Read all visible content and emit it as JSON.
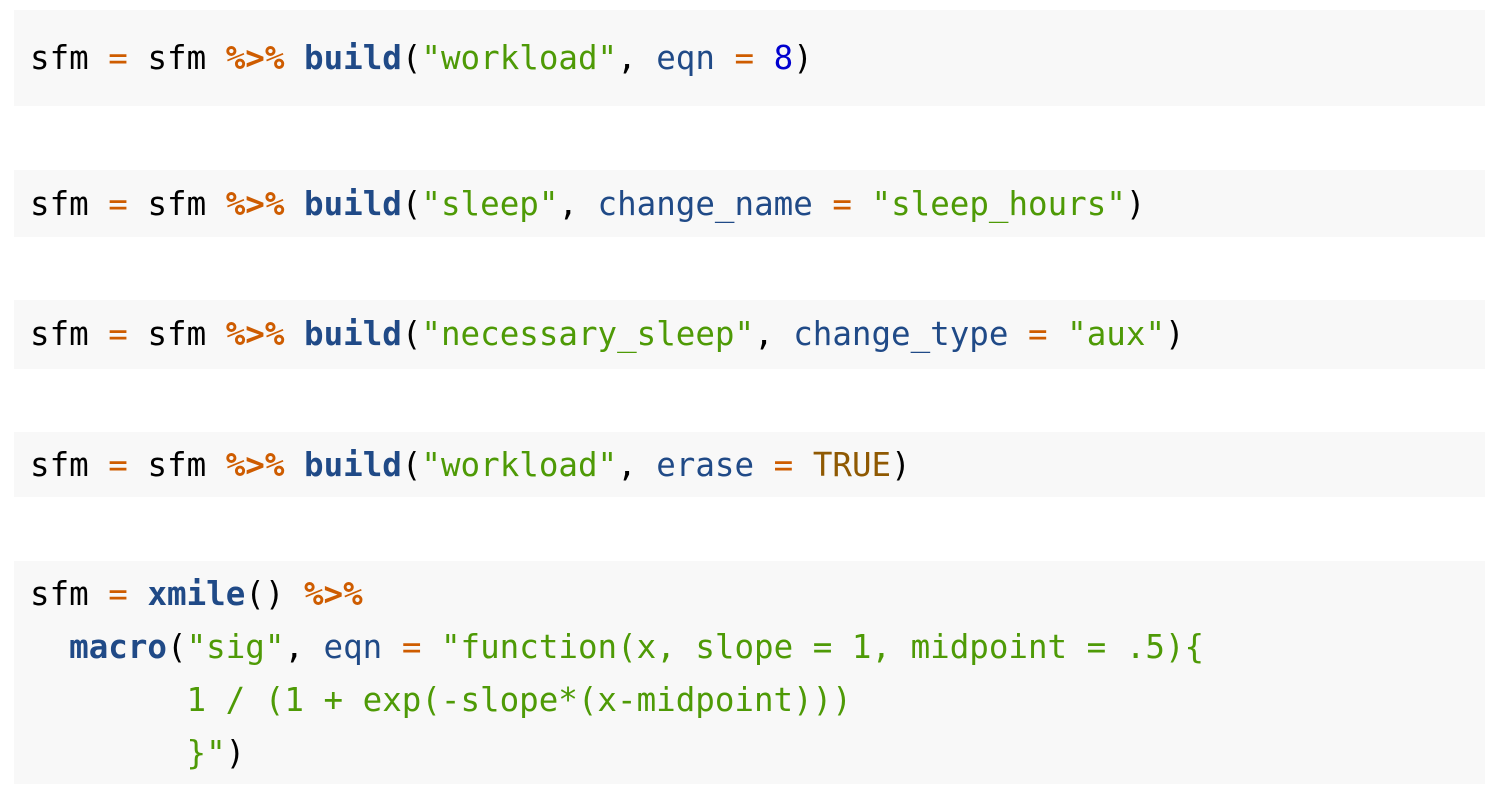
{
  "blocks": [
    {
      "lines": [
        {
          "tokens": [
            {
              "t": "sfm",
              "c": "var"
            },
            {
              "t": " ",
              "c": "punct"
            },
            {
              "t": "=",
              "c": "op"
            },
            {
              "t": " ",
              "c": "punct"
            },
            {
              "t": "sfm",
              "c": "var"
            },
            {
              "t": " ",
              "c": "punct"
            },
            {
              "t": "%>%",
              "c": "pipe"
            },
            {
              "t": " ",
              "c": "punct"
            },
            {
              "t": "build",
              "c": "fn"
            },
            {
              "t": "(",
              "c": "punct"
            },
            {
              "t": "\"workload\"",
              "c": "str"
            },
            {
              "t": ", ",
              "c": "punct"
            },
            {
              "t": "eqn",
              "c": "arg"
            },
            {
              "t": " ",
              "c": "punct"
            },
            {
              "t": "=",
              "c": "op"
            },
            {
              "t": " ",
              "c": "punct"
            },
            {
              "t": "8",
              "c": "num"
            },
            {
              "t": ")",
              "c": "punct"
            }
          ]
        }
      ]
    },
    {
      "lines": [
        {
          "tokens": [
            {
              "t": "sfm",
              "c": "var"
            },
            {
              "t": " ",
              "c": "punct"
            },
            {
              "t": "=",
              "c": "op"
            },
            {
              "t": " ",
              "c": "punct"
            },
            {
              "t": "sfm",
              "c": "var"
            },
            {
              "t": " ",
              "c": "punct"
            },
            {
              "t": "%>%",
              "c": "pipe"
            },
            {
              "t": " ",
              "c": "punct"
            },
            {
              "t": "build",
              "c": "fn"
            },
            {
              "t": "(",
              "c": "punct"
            },
            {
              "t": "\"sleep\"",
              "c": "str"
            },
            {
              "t": ", ",
              "c": "punct"
            },
            {
              "t": "change_name",
              "c": "arg"
            },
            {
              "t": " ",
              "c": "punct"
            },
            {
              "t": "=",
              "c": "op"
            },
            {
              "t": " ",
              "c": "punct"
            },
            {
              "t": "\"sleep_hours\"",
              "c": "str"
            },
            {
              "t": ")",
              "c": "punct"
            }
          ]
        }
      ]
    },
    {
      "lines": [
        {
          "tokens": [
            {
              "t": "sfm",
              "c": "var"
            },
            {
              "t": " ",
              "c": "punct"
            },
            {
              "t": "=",
              "c": "op"
            },
            {
              "t": " ",
              "c": "punct"
            },
            {
              "t": "sfm",
              "c": "var"
            },
            {
              "t": " ",
              "c": "punct"
            },
            {
              "t": "%>%",
              "c": "pipe"
            },
            {
              "t": " ",
              "c": "punct"
            },
            {
              "t": "build",
              "c": "fn"
            },
            {
              "t": "(",
              "c": "punct"
            },
            {
              "t": "\"necessary_sleep\"",
              "c": "str"
            },
            {
              "t": ", ",
              "c": "punct"
            },
            {
              "t": "change_type",
              "c": "arg"
            },
            {
              "t": " ",
              "c": "punct"
            },
            {
              "t": "=",
              "c": "op"
            },
            {
              "t": " ",
              "c": "punct"
            },
            {
              "t": "\"aux\"",
              "c": "str"
            },
            {
              "t": ")",
              "c": "punct"
            }
          ]
        }
      ]
    },
    {
      "lines": [
        {
          "tokens": [
            {
              "t": "sfm",
              "c": "var"
            },
            {
              "t": " ",
              "c": "punct"
            },
            {
              "t": "=",
              "c": "op"
            },
            {
              "t": " ",
              "c": "punct"
            },
            {
              "t": "sfm",
              "c": "var"
            },
            {
              "t": " ",
              "c": "punct"
            },
            {
              "t": "%>%",
              "c": "pipe"
            },
            {
              "t": " ",
              "c": "punct"
            },
            {
              "t": "build",
              "c": "fn"
            },
            {
              "t": "(",
              "c": "punct"
            },
            {
              "t": "\"workload\"",
              "c": "str"
            },
            {
              "t": ", ",
              "c": "punct"
            },
            {
              "t": "erase",
              "c": "arg"
            },
            {
              "t": " ",
              "c": "punct"
            },
            {
              "t": "=",
              "c": "op"
            },
            {
              "t": " ",
              "c": "punct"
            },
            {
              "t": "TRUE",
              "c": "const"
            },
            {
              "t": ")",
              "c": "punct"
            }
          ]
        }
      ]
    },
    {
      "lines": [
        {
          "tokens": [
            {
              "t": "sfm",
              "c": "var"
            },
            {
              "t": " ",
              "c": "punct"
            },
            {
              "t": "=",
              "c": "op"
            },
            {
              "t": " ",
              "c": "punct"
            },
            {
              "t": "xmile",
              "c": "fn"
            },
            {
              "t": "() ",
              "c": "punct"
            },
            {
              "t": "%>%",
              "c": "pipe"
            }
          ]
        },
        {
          "tokens": [
            {
              "t": "  ",
              "c": "punct"
            },
            {
              "t": "macro",
              "c": "fn"
            },
            {
              "t": "(",
              "c": "punct"
            },
            {
              "t": "\"sig\"",
              "c": "str"
            },
            {
              "t": ", ",
              "c": "punct"
            },
            {
              "t": "eqn",
              "c": "arg"
            },
            {
              "t": " ",
              "c": "punct"
            },
            {
              "t": "=",
              "c": "op"
            },
            {
              "t": " ",
              "c": "punct"
            },
            {
              "t": "\"function(x, slope = 1, midpoint = .5){",
              "c": "str"
            }
          ]
        },
        {
          "tokens": [
            {
              "t": "        1 / (1 + exp(-slope*(x-midpoint)))",
              "c": "str"
            }
          ]
        },
        {
          "tokens": [
            {
              "t": "        }\"",
              "c": "str"
            },
            {
              "t": ")",
              "c": "punct"
            }
          ]
        }
      ]
    }
  ],
  "colors": {
    "background": "#ffffff",
    "code_background": "#f8f8f8",
    "operator": "#ce5c00",
    "function": "#204a87",
    "argument": "#204a87",
    "string": "#4e9a06",
    "number": "#0000cf",
    "constant": "#8f5902",
    "text": "#000000"
  }
}
